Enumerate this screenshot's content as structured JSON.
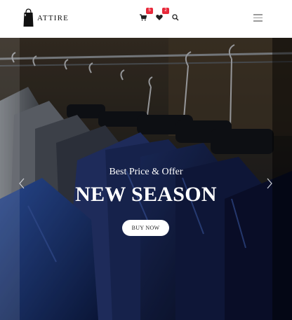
{
  "header": {
    "brand": "ATTIRE",
    "cart_count": "5",
    "wishlist_count": "2",
    "icons": [
      "bag-logo-icon",
      "cart-icon",
      "heart-icon",
      "search-icon",
      "menu-icon"
    ],
    "badge_color": "#e8283a"
  },
  "hero": {
    "subtitle": "Best Price & Offer",
    "title": "NEW SEASON",
    "button_label": "BUY NOW"
  }
}
